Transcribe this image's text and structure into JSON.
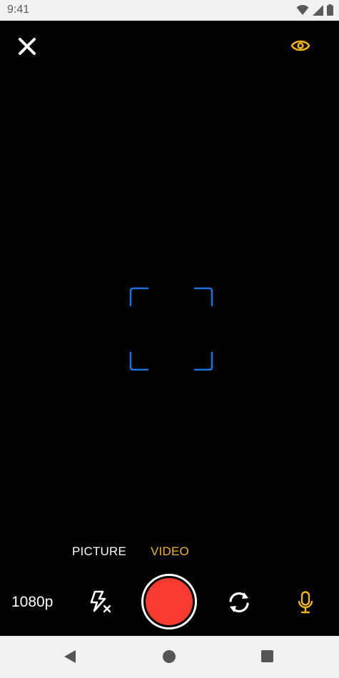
{
  "status_bar": {
    "time": "9:41",
    "icons": [
      "wifi-icon",
      "signal-icon",
      "battery-icon"
    ]
  },
  "top_bar": {
    "close_icon": "close-icon",
    "visibility_icon": "eye-icon"
  },
  "viewfinder": {
    "focus_frame_color": "#1a73d8"
  },
  "modes": {
    "tabs": [
      {
        "label": "PICTURE",
        "selected": false
      },
      {
        "label": "VIDEO",
        "selected": true
      }
    ],
    "active_color": "#f2b41b"
  },
  "controls": {
    "resolution": "1080p",
    "flash_icon": "flash-off-icon",
    "shutter_color": "#f73b2f",
    "switch_camera_icon": "switch-camera-icon",
    "mic_icon": "microphone-icon"
  },
  "nav_bar": {
    "items": [
      "back-icon",
      "home-icon",
      "recent-apps-icon"
    ]
  }
}
